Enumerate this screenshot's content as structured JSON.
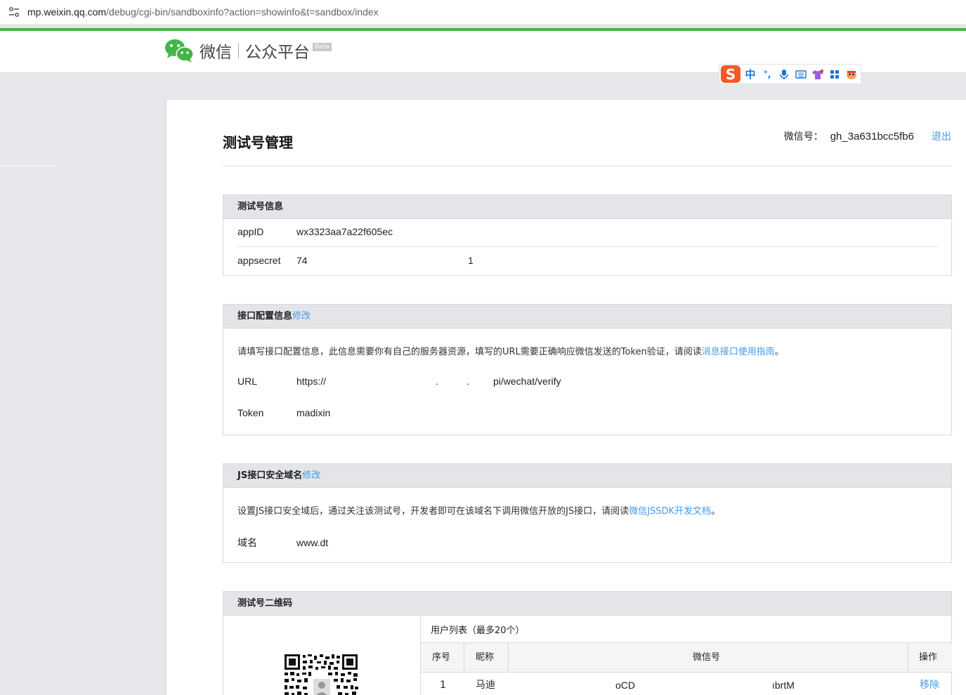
{
  "browser": {
    "url_host": "mp.weixin.qq.com",
    "url_path": "/debug/cgi-bin/sandboxinfo?action=showinfo&t=sandbox/index"
  },
  "header": {
    "brand": "微信",
    "platform": "公众平台",
    "beta": "Beta"
  },
  "ime": {
    "items": [
      "中",
      "°,",
      "mic-icon",
      "keyboard-icon",
      "shirt-icon",
      "apps-icon",
      "mascot-icon"
    ],
    "lang": "中",
    "punct": "°,"
  },
  "page": {
    "title": "测试号管理",
    "account_label": "微信号：",
    "account_value": "gh_3a631bcc5fb6",
    "logout": "退出"
  },
  "test_info": {
    "heading": "测试号信息",
    "appid_label": "appID",
    "appid_value": "wx3323aa7a22f605ec",
    "secret_label": "appsecret",
    "secret_value_start": "74",
    "secret_value_end": "1"
  },
  "api_config": {
    "heading": "接口配置信息",
    "edit": "修改",
    "desc": "请填写接口配置信息，此信息需要你有自己的服务器资源，填写的URL需要正确响应微信发送的Token验证，请阅读",
    "desc_link": "消息接口使用指南",
    "desc_end": "。",
    "url_label": "URL",
    "url_value_start": "https://",
    "url_dot1": ".",
    "url_dot2": ".",
    "url_value_end": "pi/wechat/verify",
    "token_label": "Token",
    "token_value": "madixin"
  },
  "js_domain": {
    "heading": "JS接口安全域名",
    "edit": "修改",
    "desc": "设置JS接口安全域后，通过关注该测试号，开发者即可在该域名下调用微信开放的JS接口，请阅读",
    "desc_link": "微信JSSDK开发文档",
    "desc_end": "。",
    "domain_label": "域名",
    "domain_value": "www.dt"
  },
  "qrcode": {
    "heading": "测试号二维码",
    "users_title": "用户列表（最多20个）",
    "columns": [
      "序号",
      "昵称",
      "微信号",
      "操作"
    ],
    "rows": [
      {
        "index": "1",
        "nickname": "马迪",
        "wxid_start": "oCD",
        "wxid_end": "ıbrtM",
        "action": "移除"
      }
    ]
  },
  "colors": {
    "accent_green": "#44b549",
    "link_blue": "#459ae9",
    "header_gray": "#e4e5e8",
    "page_bg": "#e7e8eb"
  }
}
